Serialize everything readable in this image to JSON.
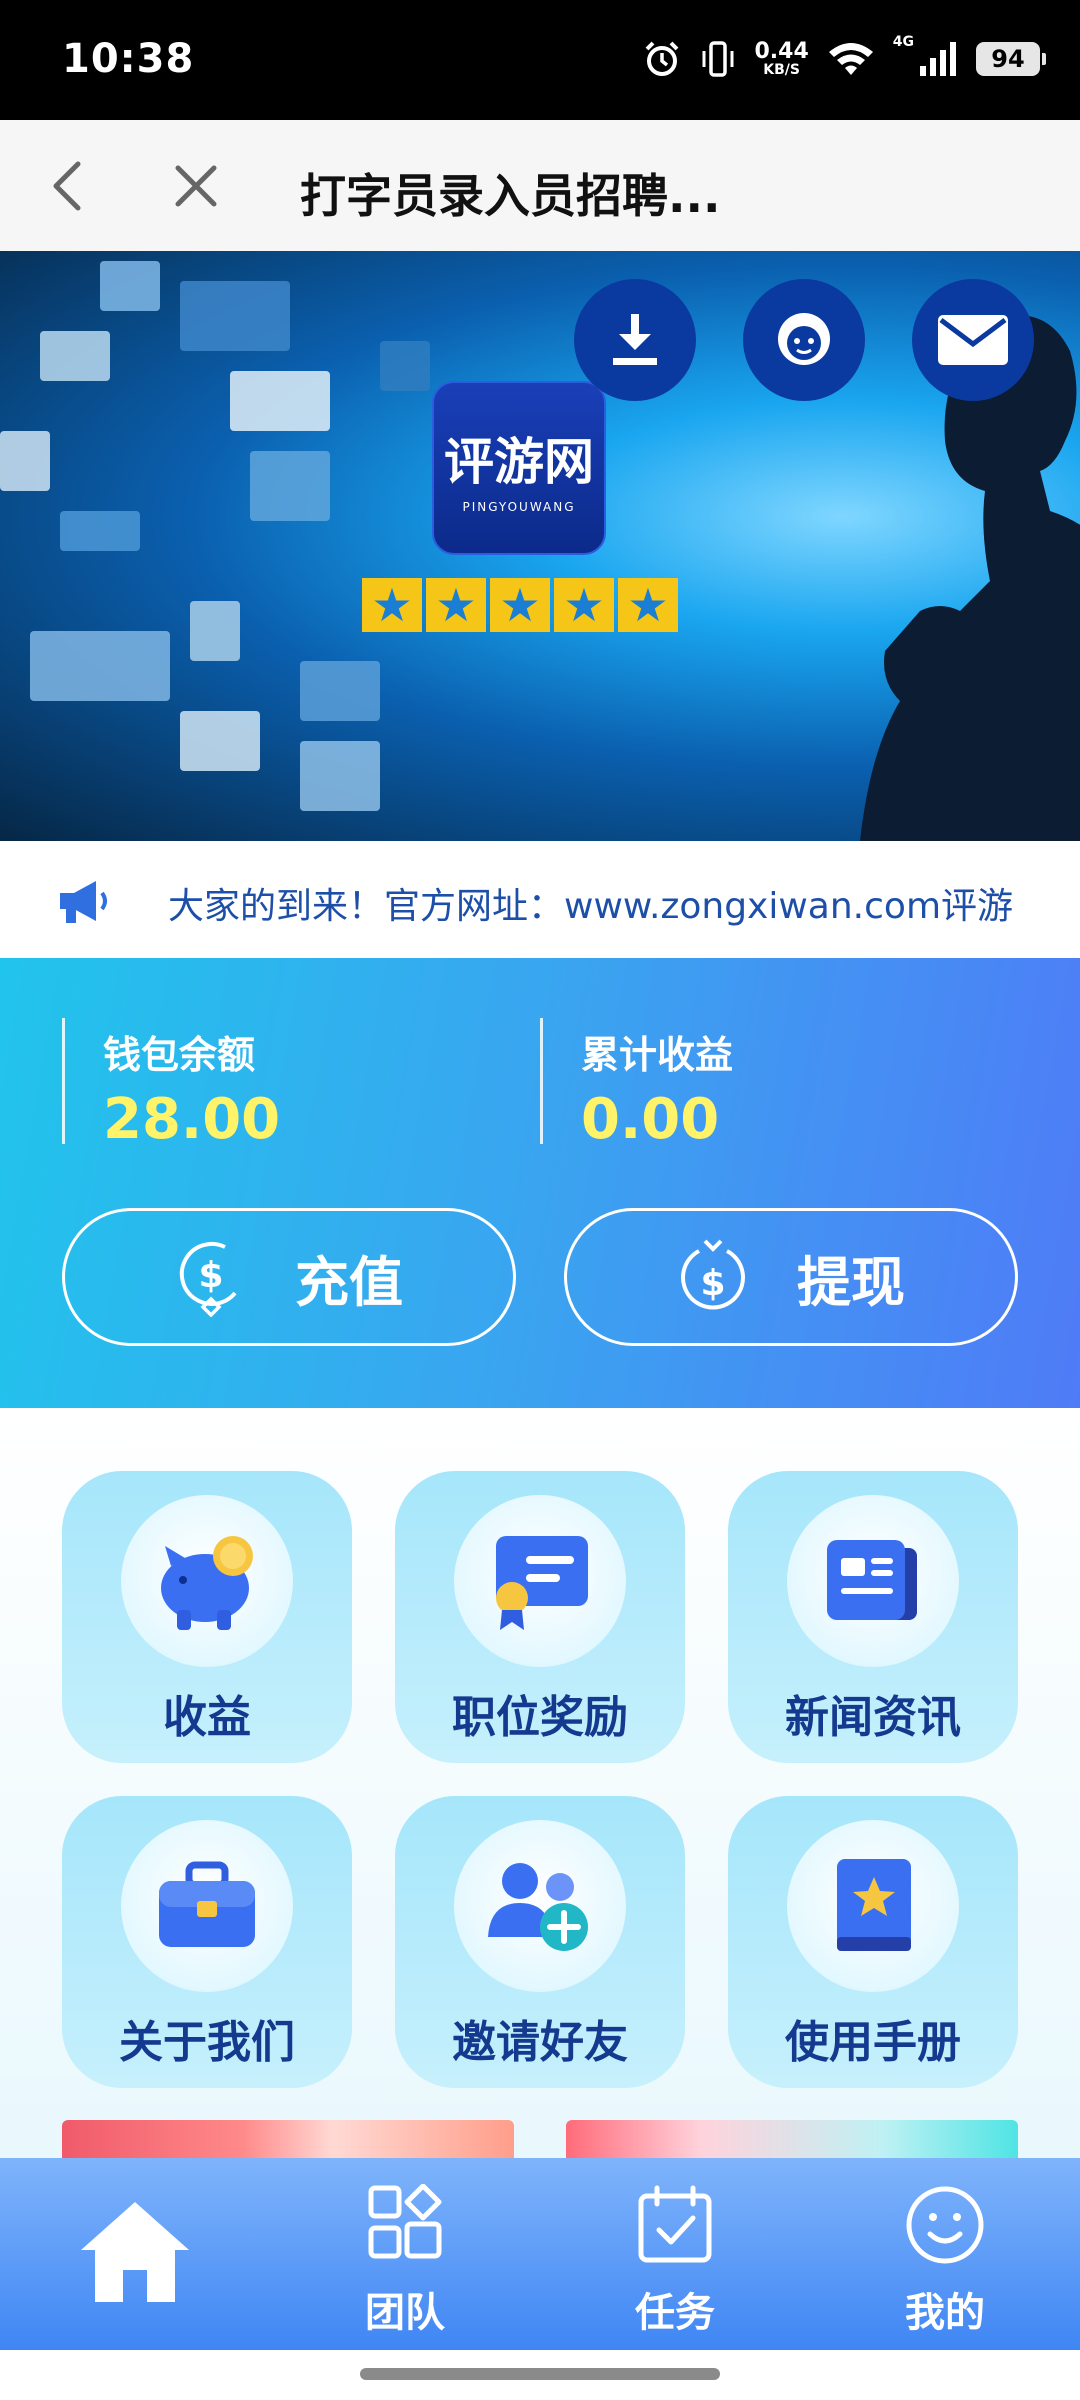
{
  "status_bar": {
    "time": "10:38",
    "net_speed_value": "0.44",
    "net_speed_unit": "KB/S",
    "network_type": "4G",
    "battery": "94",
    "icons": [
      "alarm-icon",
      "vibrate-icon",
      "wifi-icon",
      "signal-icon",
      "battery-icon"
    ]
  },
  "title_bar": {
    "title": "打字员录入员招聘...",
    "back_icon": "chevron-left-icon",
    "close_icon": "close-icon"
  },
  "banner": {
    "logo_text": "评游网",
    "logo_subtext": "PINGYOUWANG",
    "stars": 5,
    "actions": [
      "download-icon",
      "customer-service-icon",
      "mail-icon"
    ],
    "slide_index": 1,
    "slide_count": 2
  },
  "notice": {
    "icon": "megaphone-icon",
    "text": "大家的到来！官方网址：www.zongxiwan.com评游"
  },
  "wallet": {
    "balance_label": "钱包余额",
    "balance_value": "28.00",
    "earnings_label": "累计收益",
    "earnings_value": "0.00",
    "recharge_label": "充值",
    "withdraw_label": "提现",
    "value_color": "#fff36a"
  },
  "features": [
    {
      "label": "收益",
      "icon": "piggy-bank-icon"
    },
    {
      "label": "职位奖励",
      "icon": "certificate-icon"
    },
    {
      "label": "新闻资讯",
      "icon": "newspaper-icon"
    },
    {
      "label": "关于我们",
      "icon": "briefcase-icon"
    },
    {
      "label": "邀请好友",
      "icon": "add-friend-icon"
    },
    {
      "label": "使用手册",
      "icon": "manual-book-icon"
    }
  ],
  "bottom_nav": {
    "items": [
      {
        "label": "",
        "icon": "home-icon",
        "active": true
      },
      {
        "label": "团队",
        "icon": "team-grid-icon"
      },
      {
        "label": "任务",
        "icon": "task-calendar-icon"
      },
      {
        "label": "我的",
        "icon": "smiley-profile-icon"
      }
    ]
  },
  "colors": {
    "accent_blue": "#3f86f4",
    "tile_label": "#143a8f",
    "notice_text": "#1d4fa8"
  }
}
